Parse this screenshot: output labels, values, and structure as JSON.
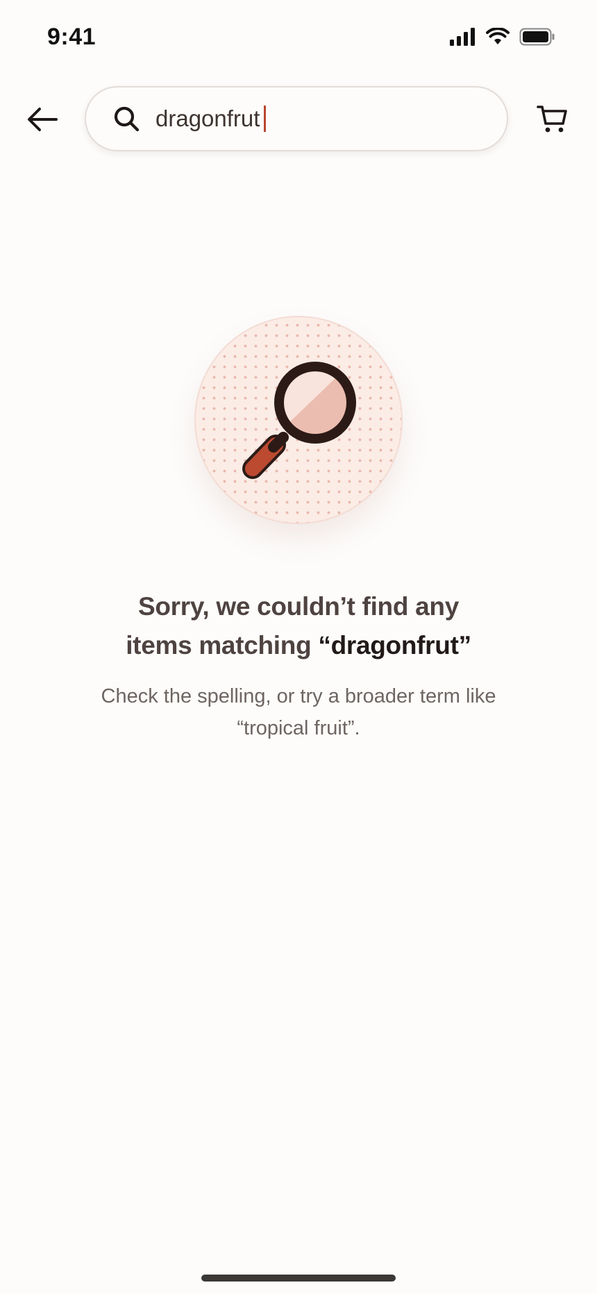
{
  "status_bar": {
    "time": "9:41"
  },
  "search": {
    "value": "dragonfrut",
    "icon": "search-icon"
  },
  "header": {
    "back_icon": "arrow-left-icon",
    "cart_icon": "cart-icon"
  },
  "empty_state": {
    "title_line1": "Sorry, we couldn’t find any",
    "title_line2_prefix": "items matching ",
    "title_query": "“dragonfrut”",
    "subtitle_line1": "Check the spelling, or try a broader term like",
    "subtitle_line2": "“tropical fruit”.",
    "illustration": "magnifying-glass-icon"
  },
  "colors": {
    "accent": "#b9452b",
    "background": "#fdfcfb",
    "illustration_bg": "#fbece6"
  }
}
